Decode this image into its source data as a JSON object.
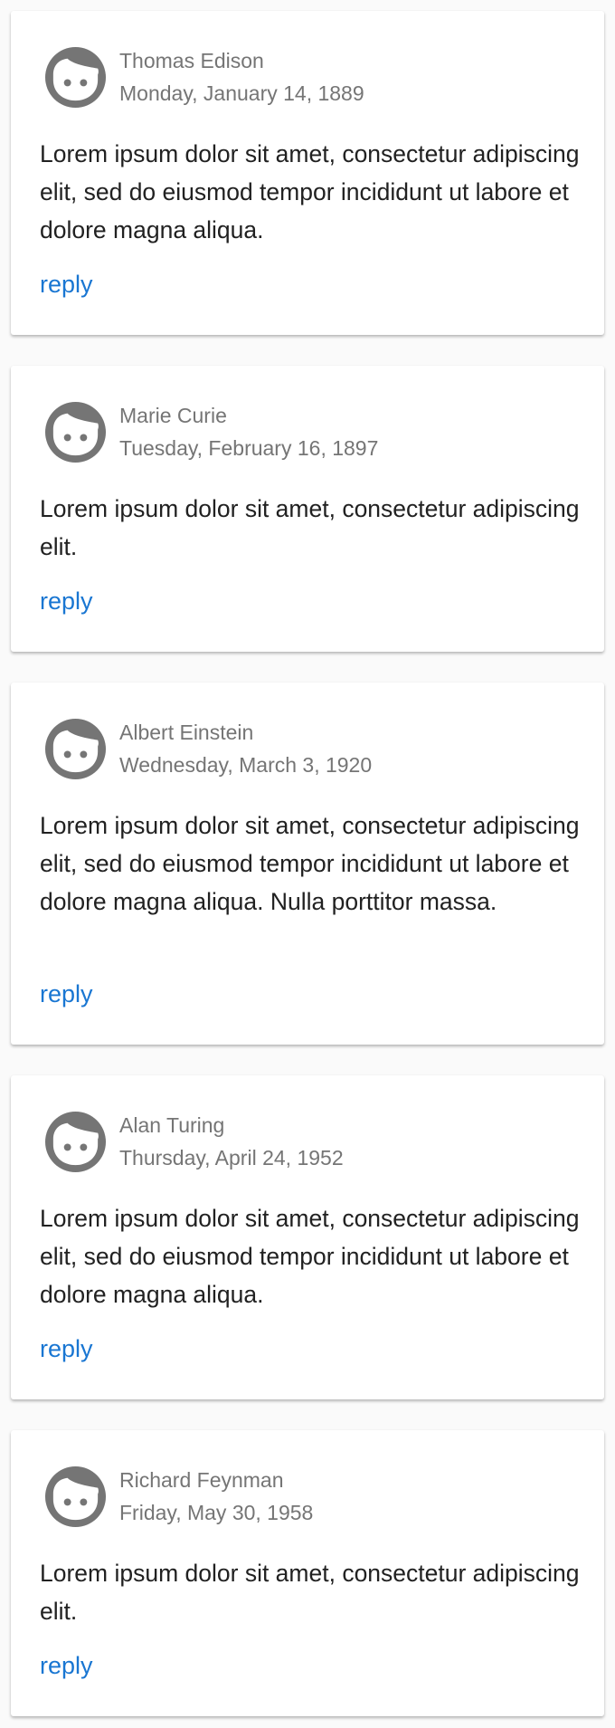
{
  "comments": [
    {
      "author": "Thomas Edison",
      "date": "Monday, January 14, 1889",
      "text": "Lorem ipsum dolor sit amet, consectetur adipiscing elit, sed do eiusmod tempor incididunt ut labore et dolore magna aliqua.",
      "reply_label": "reply"
    },
    {
      "author": "Marie Curie",
      "date": "Tuesday, February 16, 1897",
      "text": "Lorem ipsum dolor sit amet, consectetur adipiscing elit.",
      "reply_label": "reply"
    },
    {
      "author": "Albert Einstein",
      "date": "Wednesday, March 3, 1920",
      "text": "Lorem ipsum dolor sit amet, consectetur adipiscing elit, sed do eiusmod tempor incididunt ut labore et dolore magna aliqua. Nulla porttitor massa.",
      "reply_label": "reply"
    },
    {
      "author": "Alan Turing",
      "date": "Thursday, April 24, 1952",
      "text": "Lorem ipsum dolor sit amet, consectetur adipiscing elit, sed do eiusmod tempor incididunt ut labore et dolore magna aliqua.",
      "reply_label": "reply"
    },
    {
      "author": "Richard Feynman",
      "date": "Friday, May 30, 1958",
      "text": "Lorem ipsum dolor sit amet, consectetur adipiscing elit.",
      "reply_label": "reply"
    }
  ],
  "avatar_icon": "face-icon",
  "colors": {
    "background": "#fafafa",
    "card": "#ffffff",
    "meta_text": "#757575",
    "body_text": "#212121",
    "link": "#1976d2",
    "avatar": "#757575"
  }
}
